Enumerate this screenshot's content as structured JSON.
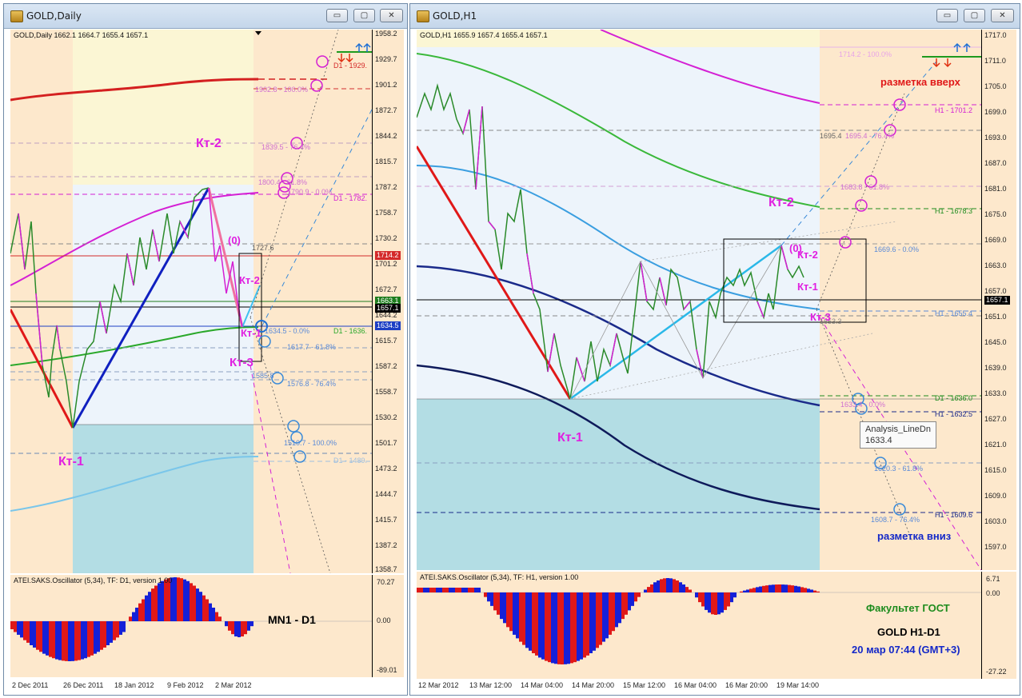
{
  "left_window": {
    "title": "GOLD,Daily",
    "symbol_info": "GOLD,Daily  1662.1 1664.7 1655.4 1657.1",
    "price_ticks": [
      "1958.2",
      "1929.7",
      "1901.2",
      "1872.7",
      "1844.2",
      "1815.7",
      "1787.2",
      "1758.7",
      "1730.2",
      "1701.2",
      "1672.7",
      "1644.2",
      "1615.7",
      "1587.2",
      "1558.7",
      "1530.2",
      "1501.7",
      "1473.2",
      "1444.7",
      "1415.7",
      "1387.2",
      "1358.7"
    ],
    "date_ticks": [
      "2 Dec 2011",
      "26 Dec 2011",
      "18 Jan 2012",
      "9 Feb 2012",
      "2 Mar 2012"
    ],
    "price_boxes": [
      {
        "text": "1714.2",
        "color": "#d42a2a"
      },
      {
        "text": "1663.1",
        "color": "#1e7d1e"
      },
      {
        "text": "1657.1",
        "color": "#000000"
      },
      {
        "text": "1634.5",
        "color": "#1d3fc4"
      }
    ],
    "level_labels": [
      "D1 - 1929.",
      "1902.8 - 100.0%",
      "1839.5 - 76.4%",
      "1800.4 - 61.8%",
      "1790.9 - 0.0%",
      "D1 - 1782.",
      "1727.6",
      "1634.5 - 0.0%",
      "D1 - 1636.",
      "1617.7 - 61.8%",
      "1585.8",
      "1576.8 - 76.4%",
      "1510.7 - 100.0%",
      "D1 - 1489."
    ],
    "wave_labels": [
      "Кт-2",
      "(0)",
      "Кт-2",
      "Кт-1",
      "Кт-3",
      "Кт-1"
    ],
    "oscillator": {
      "title": "ATEI.SAKS.Oscillator (5,34), TF: D1, version 1.00",
      "ticks": [
        "70.27",
        "0.00",
        "-89.01"
      ],
      "note": "MN1 - D1"
    }
  },
  "right_window": {
    "title": "GOLD,H1",
    "symbol_info": "GOLD,H1  1655.9 1657.4 1655.4 1657.1",
    "price_ticks": [
      "1717.0",
      "1711.0",
      "1705.0",
      "1699.0",
      "1693.0",
      "1687.0",
      "1681.0",
      "1675.0",
      "1669.0",
      "1663.0",
      "1657.0",
      "1651.0",
      "1645.0",
      "1639.0",
      "1633.0",
      "1627.0",
      "1621.0",
      "1615.0",
      "1609.0",
      "1603.0",
      "1597.0"
    ],
    "date_ticks": [
      "12 Mar 2012",
      "13 Mar 12:00",
      "14 Mar 04:00",
      "14 Mar 20:00",
      "15 Mar 12:00",
      "16 Mar 04:00",
      "16 Mar 20:00",
      "19 Mar 14:00"
    ],
    "price_box": {
      "text": "1657.1",
      "color": "#000000"
    },
    "level_labels": [
      "1714.2 - 100.0%",
      "H1 - 1701.2",
      "1695.4",
      "1695.4 - 76.4%",
      "1683.8 - 61.8%",
      "H1 - 1678.3",
      "1669.6 - 0.0%",
      "H1 - 1655.4",
      "1653.3",
      "D1 - 1636.0",
      "1633.4 - 0.0%",
      "H1 - 1632.5",
      "1620.3 - 61.8%",
      "1608.7 - 76.4%",
      "H1 - 1609.6"
    ],
    "wave_labels": [
      "Кт-2",
      "(0)",
      "Кт-2",
      "Кт-1",
      "Кт-3",
      "Кт-1"
    ],
    "annotations": {
      "markup_up": "разметка вверх",
      "markup_down": "разметка вниз"
    },
    "tooltip": {
      "line1": "Analysis_LineDn",
      "line2": "1633.4"
    },
    "oscillator": {
      "title": "ATEI.SAKS.Oscillator (5,34), TF: H1, version 1.00",
      "ticks": [
        "6.71",
        "0.00",
        "-27.22"
      ],
      "faculty": "Факультет ГОСТ",
      "instrument": "GOLD   H1-D1",
      "datetime": "20 мар 07:44 (GMT+3)"
    }
  },
  "colors": {
    "chart_bg": "#fde8cc",
    "accent_magenta": "#e020e0",
    "accent_green": "#1e8c1e",
    "accent_blue": "#1428c8"
  },
  "window_buttons": {
    "minimize": "▭",
    "maximize": "▢",
    "close": "✕"
  }
}
